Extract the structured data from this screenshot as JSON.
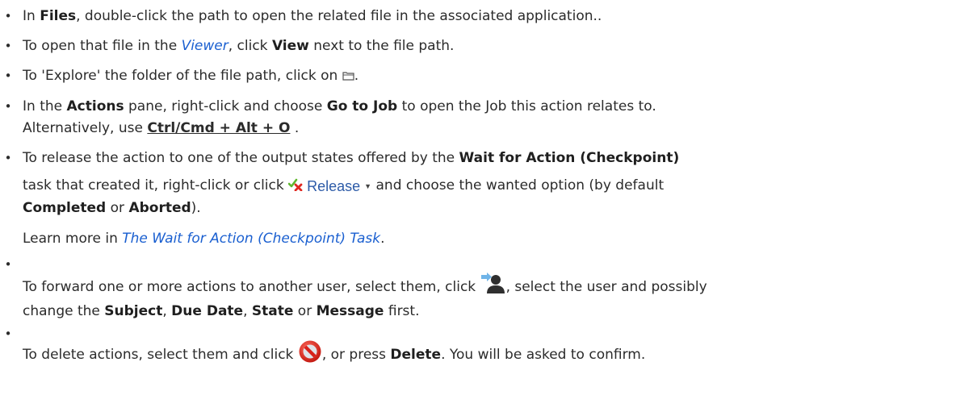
{
  "bullet_char": "•",
  "colors": {
    "text": "#2b2b2b",
    "link": "#1a5fd0",
    "release_label": "#2d5ba8",
    "delete_icon": "#d8221b"
  },
  "items": [
    {
      "p1": "In ",
      "b1": "Files",
      "p2": ", double-click the path to open the related file in the associated application.."
    },
    {
      "p1": "To open that file in the ",
      "link": "Viewer",
      "p2": ", click ",
      "b1": "View",
      "p3": " next to the file path."
    },
    {
      "p1": "To 'Explore' the folder of the file path, click on ",
      "icon": "folder-icon",
      "p2": "."
    },
    {
      "p1": "In the ",
      "b1": "Actions",
      "p2": " pane, right-click and choose ",
      "b2": "Go to Job",
      "p3": " to open the Job this action relates to.",
      "p4": "Alternatively, use ",
      "shortcut": "Ctrl/Cmd + Alt + O",
      "p5": " ."
    },
    {
      "p1": "To release the action to one of the output states offered by the ",
      "b1": "Wait for Action (Checkpoint)",
      "p2": "task that created it, right-click or click ",
      "release_label": "Release",
      "release_icon": "checkmark-cross-icon",
      "release_chevron": "chevron-down-icon",
      "p3": " and choose the wanted option (by default",
      "b2": "Completed",
      "p4": " or ",
      "b3": "Aborted",
      "p5": ").",
      "learn_prefix": "Learn more in ",
      "learn_link": "The Wait for Action (Checkpoint) Task",
      "learn_suffix": "."
    },
    {
      "p1": "To forward one or more actions to another user, select them, click ",
      "icon": "forward-user-icon",
      "p2": ", select the user and possibly",
      "p3": "change the ",
      "b1": "Subject",
      "p4": ", ",
      "b2": "Due Date",
      "p5": ", ",
      "b3": "State",
      "p6": " or ",
      "b4": "Message",
      "p7": " first."
    },
    {
      "p1": "To delete actions, select them and click ",
      "icon": "delete-icon",
      "p2": ", or press ",
      "b1": "Delete",
      "p3": ". You will be asked to confirm."
    }
  ]
}
